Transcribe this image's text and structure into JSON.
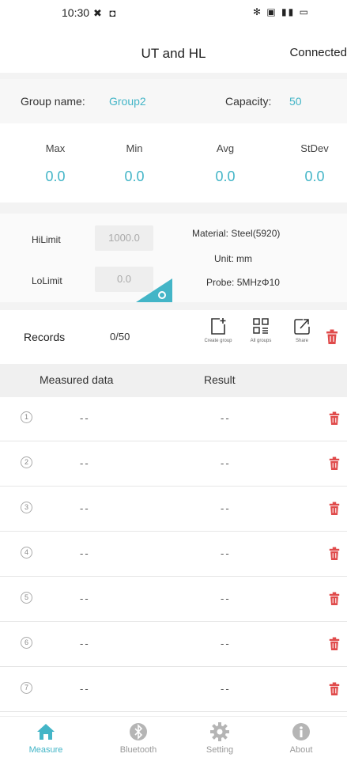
{
  "status_bar": {
    "time": "10:30",
    "left_icons": "✖ ◘",
    "right_icons": "✻ ▣ ▮▮ ▭"
  },
  "header": {
    "title": "UT and HL",
    "connection": "Connected"
  },
  "group": {
    "name_label": "Group name:",
    "name_value": "Group2",
    "capacity_label": "Capacity:",
    "capacity_value": "50"
  },
  "stats": [
    {
      "label": "Max",
      "value": "0.0"
    },
    {
      "label": "Min",
      "value": "0.0"
    },
    {
      "label": "Avg",
      "value": "0.0"
    },
    {
      "label": "StDev",
      "value": "0.0"
    }
  ],
  "limits": {
    "hi_label": "HiLimit",
    "hi_value": "1000.0",
    "lo_label": "LoLimit",
    "lo_value": "0.0"
  },
  "material": {
    "material_line": "Material: Steel(5920)",
    "unit_line": "Unit: mm",
    "probe_line": "Probe: 5MHzΦ10"
  },
  "records": {
    "label": "Records",
    "count": "0/50",
    "create_group": "Create group",
    "all_groups": "All groups",
    "share": "Share"
  },
  "table": {
    "col_data": "Measured data",
    "col_result": "Result",
    "rows": [
      {
        "num": "1",
        "data": "--",
        "result": "--"
      },
      {
        "num": "2",
        "data": "--",
        "result": "--"
      },
      {
        "num": "3",
        "data": "--",
        "result": "--"
      },
      {
        "num": "4",
        "data": "--",
        "result": "--"
      },
      {
        "num": "5",
        "data": "--",
        "result": "--"
      },
      {
        "num": "6",
        "data": "--",
        "result": "--"
      },
      {
        "num": "7",
        "data": "--",
        "result": "--"
      }
    ]
  },
  "nav": [
    {
      "label": "Measure",
      "icon": "home-icon",
      "active": true
    },
    {
      "label": "Bluetooth",
      "icon": "bluetooth-icon",
      "active": false
    },
    {
      "label": "Setting",
      "icon": "gear-icon",
      "active": false
    },
    {
      "label": "About",
      "icon": "info-icon",
      "active": false
    }
  ],
  "colors": {
    "accent": "#43b5c7",
    "delete": "#e04b4b"
  }
}
